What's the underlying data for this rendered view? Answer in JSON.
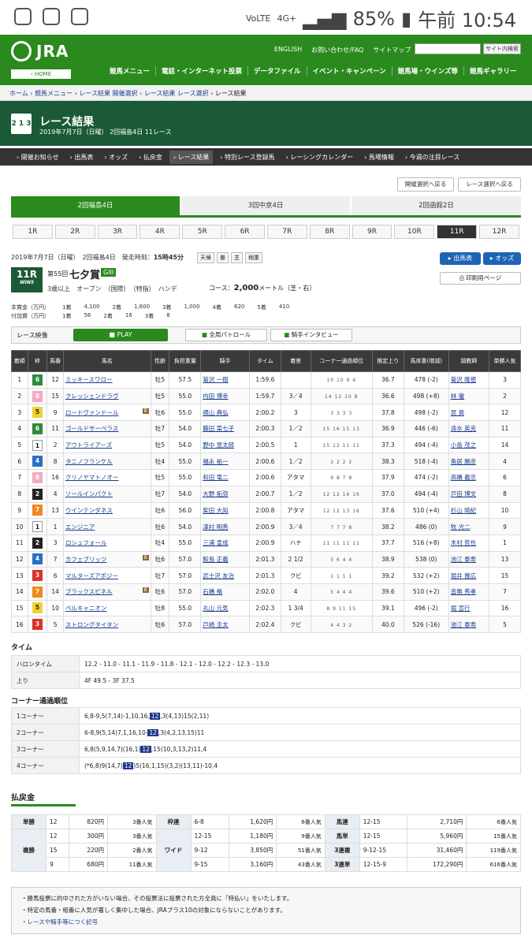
{
  "status": {
    "network": "4G+",
    "battery": "85%",
    "time": "午前 10:54",
    "volte": "VoLTE"
  },
  "header": {
    "logo": "JRA",
    "home": "‹ HOME",
    "links": [
      "ENGLISH",
      "お問い合わせ/FAQ",
      "サイトマップ"
    ],
    "search_btn": "サイト内検索",
    "nav": [
      "競馬メニュー",
      "電話・インターネット投票",
      "データファイル",
      "イベント・キャンペーン",
      "競馬場・ウインズ等",
      "競馬ギャラリー"
    ]
  },
  "breadcrumb": [
    "ホーム",
    "競馬メニュー",
    "レース結果 開催選択",
    "レース結果 レース選択",
    "レース結果"
  ],
  "title": {
    "icon": "2 1 3",
    "main": "レース結果",
    "sub": "2019年7月7日（日曜） 2回福島4日 11レース"
  },
  "subnav": [
    "開催お知らせ",
    "出馬表",
    "オッズ",
    "払戻金",
    "レース結果",
    "特別レース登録馬",
    "レーシングカレンダー",
    "馬場情報",
    "今週の注目レース"
  ],
  "back": {
    "meeting": "開催選択へ戻る",
    "race": "レース選択へ戻る"
  },
  "meetings": [
    "2回福島4日",
    "3回中京4日",
    "2回函館2日"
  ],
  "races": [
    "1R",
    "2R",
    "3R",
    "4R",
    "5R",
    "6R",
    "7R",
    "8R",
    "9R",
    "10R",
    "11R",
    "12R"
  ],
  "race": {
    "date": "2019年7月7日（日曜）",
    "meeting": "2回福島4日",
    "start_label": "発走時刻：",
    "start": "15時45分",
    "weather": [
      "天候",
      "曇",
      "芝",
      "稍重"
    ],
    "badge": "11R",
    "badge2": "WIN5",
    "num": "第55回",
    "name": "七夕賞",
    "grade": "GIII",
    "cond": "3歳以上　オープン　（国際）　（特指）　ハンデ",
    "course_label": "コース：",
    "course": "2,000",
    "course_unit": "メートル（芝・右）",
    "btn_entry": "出馬表",
    "btn_odds": "オッズ",
    "btn_print": "印刷用ページ",
    "prize1": [
      "本賞金（万円）",
      "1着",
      "4,100",
      "2着",
      "1,600",
      "3着",
      "1,000",
      "4着",
      "620",
      "5着",
      "410"
    ],
    "prize2": [
      "付加賞（万円）",
      "1着",
      "56",
      "2着",
      "16",
      "3着",
      "8"
    ]
  },
  "video": {
    "label": "レース映像",
    "play": "PLAY",
    "patrol": "全周パトロール",
    "interview": "騎手インタビュー"
  },
  "table": {
    "headers": [
      "着順",
      "枠",
      "馬番",
      "馬名",
      "性齢",
      "負担重量",
      "騎手",
      "タイム",
      "着差",
      "コーナー通過順位",
      "推定上り",
      "馬体重(増減)",
      "調教師",
      "単勝人気"
    ],
    "rows": [
      [
        "1",
        "6",
        "12",
        "ミッキースワロー",
        "牡5",
        "57.5",
        "菊沢 一樹",
        "1:59.6",
        "",
        "10 10 9 4",
        "36.7",
        "478 (-2)",
        "菊沢 隆徳",
        "3"
      ],
      [
        "2",
        "8",
        "15",
        "クレッシェンドラヴ",
        "牡5",
        "55.0",
        "内田 博幸",
        "1:59.7",
        "3／4",
        "14 12 10 8",
        "36.6",
        "498 (+8)",
        "林 徹",
        "2"
      ],
      [
        "3",
        "5",
        "9",
        "ロードヴァンドール",
        "牡6",
        "55.0",
        "横山 典弘",
        "2:00.2",
        "3",
        "3 3 3 3",
        "37.8",
        "498 (-2)",
        "昆 貢",
        "12"
      ],
      [
        "4",
        "6",
        "11",
        "ゴールドサーベラス",
        "牡7",
        "54.0",
        "藤田 菜七子",
        "2:00.3",
        "1／2",
        "15 16 15 13",
        "36.9",
        "446 (-6)",
        "清水 英克",
        "11"
      ],
      [
        "5",
        "1",
        "2",
        "アウトライアーズ",
        "牡5",
        "54.0",
        "野中 悠太郎",
        "2:00.5",
        "1",
        "15 12 11 11",
        "37.3",
        "494 (-4)",
        "小島 茂之",
        "14"
      ],
      [
        "6",
        "4",
        "8",
        "タニノフランケル",
        "牡4",
        "55.0",
        "福永 祐一",
        "2:00.6",
        "1／2",
        "2 2 2 2",
        "38.3",
        "518 (-4)",
        "角居 勝彦",
        "4"
      ],
      [
        "7",
        "8",
        "16",
        "クリノヤマトノオー",
        "牡5",
        "55.0",
        "和田 竜二",
        "2:00.6",
        "アタマ",
        "9 8 7 8",
        "37.9",
        "474 (-2)",
        "高橋 義忠",
        "6"
      ],
      [
        "8",
        "2",
        "4",
        "ソールインパクト",
        "牡7",
        "54.0",
        "大野 拓弥",
        "2:00.7",
        "1／2",
        "12 12 16 16",
        "37.0",
        "494 (-4)",
        "戸田 博文",
        "8"
      ],
      [
        "9",
        "7",
        "13",
        "ウインテンダネス",
        "牡6",
        "56.0",
        "柴田 大知",
        "2:00.8",
        "アタマ",
        "12 12 13 16",
        "37.6",
        "510 (+4)",
        "杉山 晴紀",
        "10"
      ],
      [
        "10",
        "1",
        "1",
        "エンジニア",
        "牡6",
        "54.0",
        "津村 明秀",
        "2:00.9",
        "3／4",
        "7 7 7 8",
        "38.2",
        "486 (0)",
        "牧 光二",
        "9"
      ],
      [
        "11",
        "2",
        "3",
        "ロシュフォール",
        "牡4",
        "55.0",
        "三浦 皇成",
        "2:00.9",
        "ハナ",
        "11 11 11 11",
        "37.7",
        "516 (+8)",
        "木村 哲也",
        "1"
      ],
      [
        "12",
        "4",
        "7",
        "カフェブリッツ",
        "牡6",
        "57.0",
        "鮫島 正義",
        "2:01.3",
        "2 1/2",
        "5 6 4 4",
        "38.9",
        "538 (0)",
        "池江 泰寿",
        "13"
      ],
      [
        "13",
        "3",
        "6",
        "マルターズアポジー",
        "牡7",
        "57.0",
        "武士沢 友治",
        "2:01.3",
        "クビ",
        "1 1 1 1",
        "39.2",
        "532 (+2)",
        "堀井 雅広",
        "15"
      ],
      [
        "14",
        "7",
        "14",
        "ブラックスピネル",
        "牡6",
        "57.0",
        "石橋 脩",
        "2:02.0",
        "4",
        "5 4 4 4",
        "39.6",
        "510 (+2)",
        "音無 秀孝",
        "7"
      ],
      [
        "15",
        "5",
        "10",
        "ベルキャニオン",
        "牡8",
        "55.0",
        "丸山 元気",
        "2:02.3",
        "1 3/4",
        "8 9 11 15",
        "39.1",
        "496 (-2)",
        "堀 宣行",
        "16"
      ],
      [
        "16",
        "3",
        "5",
        "ストロングタイタン",
        "牡6",
        "57.0",
        "戸崎 圭太",
        "2:02.4",
        "クビ",
        "4 4 3 2",
        "40.0",
        "526 (-16)",
        "池江 泰寿",
        "5"
      ]
    ]
  },
  "blinkers": [
    "ロードヴァンドール",
    "カフェブリッツ",
    "ブラックスピネル"
  ],
  "timing": {
    "title": "タイム",
    "rows": [
      [
        "ハロンタイム",
        "12.2 - 11.0 - 11.1 - 11.9 - 11.8 - 12.1 - 12.0 - 12.2 - 12.3 - 13.0"
      ],
      [
        "上り",
        "4F 49.5 - 3F 37.5"
      ]
    ]
  },
  "corners": {
    "title": "コーナー通過順位",
    "rows": [
      [
        "1コーナー",
        "6,8-9,5(7,14)-1,10,16,",
        "12",
        ",3(4,13)15(2,11)"
      ],
      [
        "2コーナー",
        "6-8,9(5,14)7,1,16,10-",
        "12",
        ",3(4,2,13,15)11"
      ],
      [
        "3コーナー",
        "6,8(5,9,14,7)(16,1)",
        "12",
        ",15(10,3,13,2)11,4"
      ],
      [
        "4コーナー",
        "(*6,8)9(14,7)",
        "12",
        ")5(16,1,15)(3,2)(13,11)-10,4"
      ]
    ]
  },
  "payout": {
    "title": "払戻金",
    "tansho": {
      "k": "単勝",
      "n": "12",
      "y": "820円",
      "p": "3番人気"
    },
    "fukusho": {
      "k": "複勝",
      "rows": [
        [
          "12",
          "300円",
          "3番人気"
        ],
        [
          "15",
          "220円",
          "2番人気"
        ],
        [
          "9",
          "680円",
          "11番人気"
        ]
      ]
    },
    "wakuren": {
      "k": "枠連",
      "n": "6-8",
      "y": "1,620円",
      "p": "6番人気"
    },
    "wide": {
      "k": "ワイド",
      "rows": [
        [
          "12-15",
          "1,180円",
          "9番人気"
        ],
        [
          "9-12",
          "3,850円",
          "51番人気"
        ],
        [
          "9-15",
          "3,160円",
          "43番人気"
        ]
      ]
    },
    "umaren": {
      "k": "馬連",
      "n": "12-15",
      "y": "2,710円",
      "p": "6番人気"
    },
    "umatan": {
      "k": "馬単",
      "n": "12-15",
      "y": "5,960円",
      "p": "15番人気"
    },
    "sanrenpuku": {
      "k": "3連複",
      "n": "9-12-15",
      "y": "31,460円",
      "p": "119番人気"
    },
    "sanrentan": {
      "k": "3連単",
      "n": "12-15-9",
      "y": "172,290円",
      "p": "616番人気"
    }
  },
  "notes": [
    "勝馬投票に的中された方がいない場合、その投票法に投票された方全員に「特払い」をいたします。",
    "特定の馬番・組番に人気が著しく集中した場合、JRAプラス10の対象にならないことがあります。",
    "レースや騎手等につく記号"
  ],
  "colors": {
    "waku": {
      "1": "#ffffff",
      "2": "#222222",
      "3": "#d9322a",
      "4": "#2b6fc4",
      "5": "#f2d22e",
      "6": "#2e8b3e",
      "7": "#f08a1c",
      "8": "#f4a9c0"
    }
  }
}
